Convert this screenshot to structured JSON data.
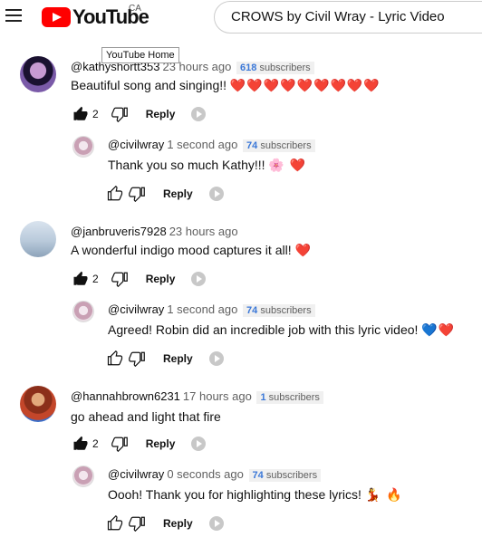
{
  "header": {
    "logo_text": "YouTube",
    "country": "CA",
    "search_value": "CROWS by Civil Wray - Lyric Video",
    "tooltip": "YouTube Home"
  },
  "threads": [
    {
      "author": "@kathyshortt353",
      "time": "23 hours ago",
      "subs_count": "618",
      "subs_label": "subscribers",
      "text": "Beautiful song and singing!!",
      "emoji": "❤️❤️❤️❤️❤️❤️❤️❤️❤️",
      "likes": "2",
      "reply_label": "Reply",
      "reply": {
        "author": "@civilwray",
        "time": "1 second ago",
        "subs_count": "74",
        "subs_label": "subscribers",
        "text": "Thank you so much Kathy!!!",
        "emoji": "🌸 ❤️",
        "reply_label": "Reply"
      }
    },
    {
      "author": "@janbruveris7928",
      "time": "23 hours ago",
      "text": "A wonderful indigo mood captures it all!",
      "emoji": "❤️",
      "likes": "2",
      "reply_label": "Reply",
      "reply": {
        "author": "@civilwray",
        "time": "1 second ago",
        "subs_count": "74",
        "subs_label": "subscribers",
        "text": "Agreed! Robin did an incredible job with this lyric video!",
        "emoji": "💙❤️",
        "reply_label": "Reply"
      }
    },
    {
      "author": "@hannahbrown6231",
      "time": "17 hours ago",
      "subs_count": "1",
      "subs_label": "subscribers",
      "text": "go ahead and light that fire",
      "emoji": "",
      "likes": "2",
      "reply_label": "Reply",
      "reply": {
        "author": "@civilwray",
        "time": "0 seconds ago",
        "subs_count": "74",
        "subs_label": "subscribers",
        "text": "Oooh! Thank you for highlighting these lyrics!",
        "emoji": "💃 🔥",
        "reply_label": "Reply"
      }
    }
  ]
}
